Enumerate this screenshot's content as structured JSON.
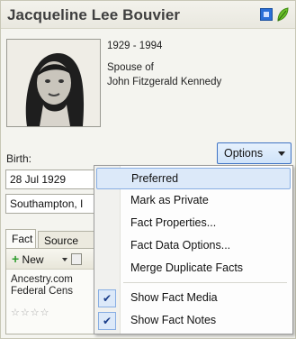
{
  "header": {
    "name": "Jacqueline Lee Bouvier",
    "icons": [
      "media-icon",
      "leaf-hint-icon"
    ]
  },
  "person": {
    "dates": "1929 - 1994",
    "relation_line1": "Spouse of",
    "relation_line2": "John Fitzgerald Kennedy"
  },
  "fact": {
    "label": "Birth:",
    "options_label": "Options",
    "date_value": "28 Jul 1929",
    "place_value": "Southampton, I"
  },
  "tabs": {
    "fact": "Fact",
    "sources": "Source"
  },
  "toolbar": {
    "new_label": "New"
  },
  "sources": {
    "line1": "Ancestry.com",
    "line2": "Federal Cens",
    "stars": "☆☆☆☆"
  },
  "menu": {
    "items": [
      {
        "label": "Preferred",
        "checked": false,
        "highlighted": true
      },
      {
        "label": "Mark as Private",
        "checked": false
      },
      {
        "label": "Fact Properties...",
        "checked": false
      },
      {
        "label": "Fact Data Options...",
        "checked": false
      },
      {
        "label": "Merge Duplicate Facts",
        "checked": false
      },
      {
        "label": "Show Fact Media",
        "checked": true
      },
      {
        "label": "Show Fact Notes",
        "checked": true
      }
    ],
    "check_glyph": "✔"
  },
  "colors": {
    "accent": "#2a6fd8",
    "highlight": "#dce9f9",
    "highlight_border": "#88aee3",
    "leaf": "#6bbf2a"
  }
}
